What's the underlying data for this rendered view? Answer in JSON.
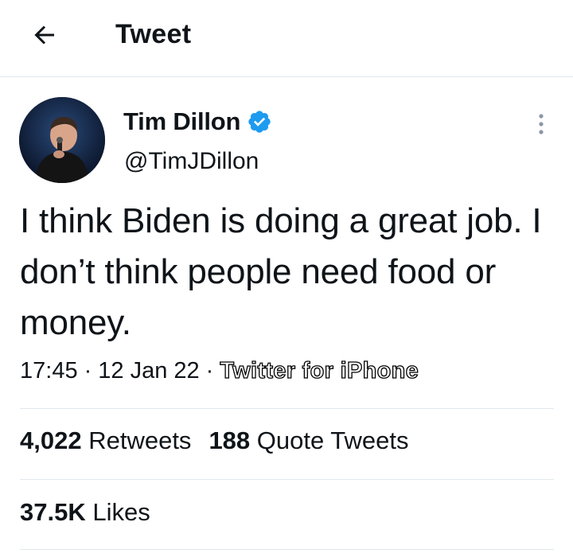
{
  "header": {
    "title": "Tweet"
  },
  "tweet": {
    "author_name": "Tim Dillon",
    "handle": "@TimJDillon",
    "verified": true,
    "text": "I think Biden is doing a great job. I don’t think people need food or money.",
    "time": "17:45",
    "date": "12 Jan 22",
    "source": "Twitter for iPhone",
    "separator": "·"
  },
  "stats": {
    "retweets_count": "4,022",
    "retweets_label": "Retweets",
    "quotes_count": "188",
    "quotes_label": "Quote Tweets",
    "likes_count": "37.5K",
    "likes_label": "Likes"
  },
  "colors": {
    "verified_blue": "#1d9bf0",
    "divider": "#e1e8ed",
    "text": "#0f1419"
  }
}
